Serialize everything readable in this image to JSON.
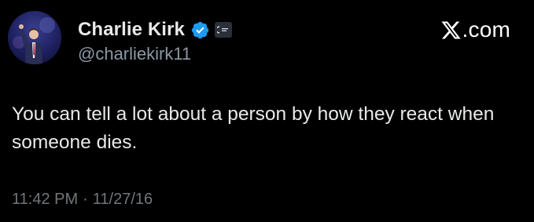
{
  "author": {
    "display_name": "Charlie Kirk",
    "handle": "@charliekirk11",
    "verified": true,
    "badge_color": "#1d9bf0"
  },
  "brand": {
    "label": ".com",
    "logo_icon": "x-logo-icon"
  },
  "tweet": {
    "text": "You can tell a lot about a person by how they react when someone dies.",
    "time": "11:42 PM",
    "separator": "·",
    "date": "11/27/16"
  },
  "colors": {
    "background": "#000000",
    "primary_text": "#e7e9ea",
    "secondary_text": "#71767b"
  }
}
